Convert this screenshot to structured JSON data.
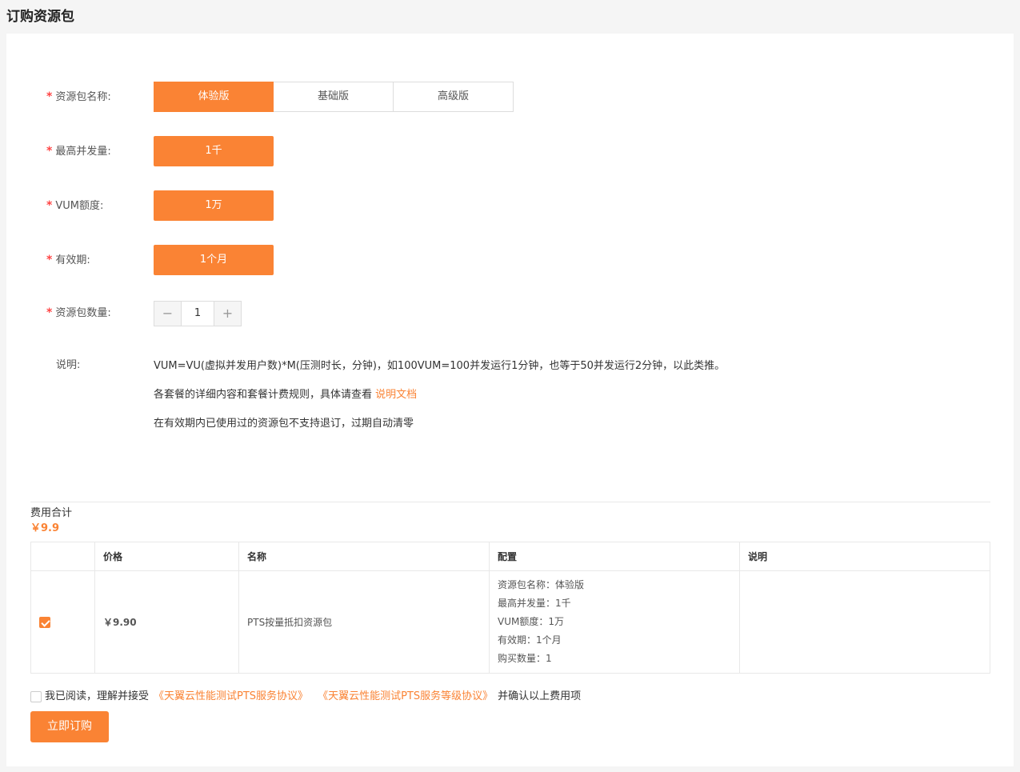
{
  "page": {
    "title": "订购资源包"
  },
  "form": {
    "package_name": {
      "label": "资源包名称:",
      "options": [
        "体验版",
        "基础版",
        "高级版"
      ],
      "selected": "体验版"
    },
    "max_concurrency": {
      "label": "最高并发量:",
      "value": "1千"
    },
    "vum_quota": {
      "label": "VUM额度:",
      "value": "1万"
    },
    "validity": {
      "label": "有效期:",
      "value": "1个月"
    },
    "quantity": {
      "label": "资源包数量:",
      "value": "1",
      "minus": "−",
      "plus": "+"
    },
    "notes": {
      "label": "说明:",
      "line1": "VUM=VU(虚拟并发用户数)*M(压测时长，分钟)，如100VUM=100并发运行1分钟，也等于50并发运行2分钟，以此类推。",
      "line2_prefix": "各套餐的详细内容和套餐计费规则，具体请查看",
      "line2_link": "说明文档",
      "line3": "在有效期内已使用过的资源包不支持退订，过期自动清零"
    }
  },
  "summary": {
    "total_label": "费用合计",
    "total_value": "￥9.9"
  },
  "table": {
    "headers": [
      "",
      "价格",
      "名称",
      "配置",
      "说明"
    ],
    "row": {
      "checked": true,
      "price": "￥9.90",
      "name": "PTS按量抵扣资源包",
      "config": [
        "资源包名称：体验版",
        "最高并发量：1千",
        "VUM额度：1万",
        "有效期：1个月",
        "购买数量：1"
      ],
      "note": ""
    }
  },
  "agreement": {
    "prefix": "我已阅读，理解并接受",
    "link1": "《天翼云性能测试PTS服务协议》",
    "link2": "《天翼云性能测试PTS服务等级协议》",
    "suffix": "并确认以上费用项"
  },
  "submit_label": "立即订购",
  "colors": {
    "accent": "#fa8334",
    "required": "#ff4444"
  }
}
